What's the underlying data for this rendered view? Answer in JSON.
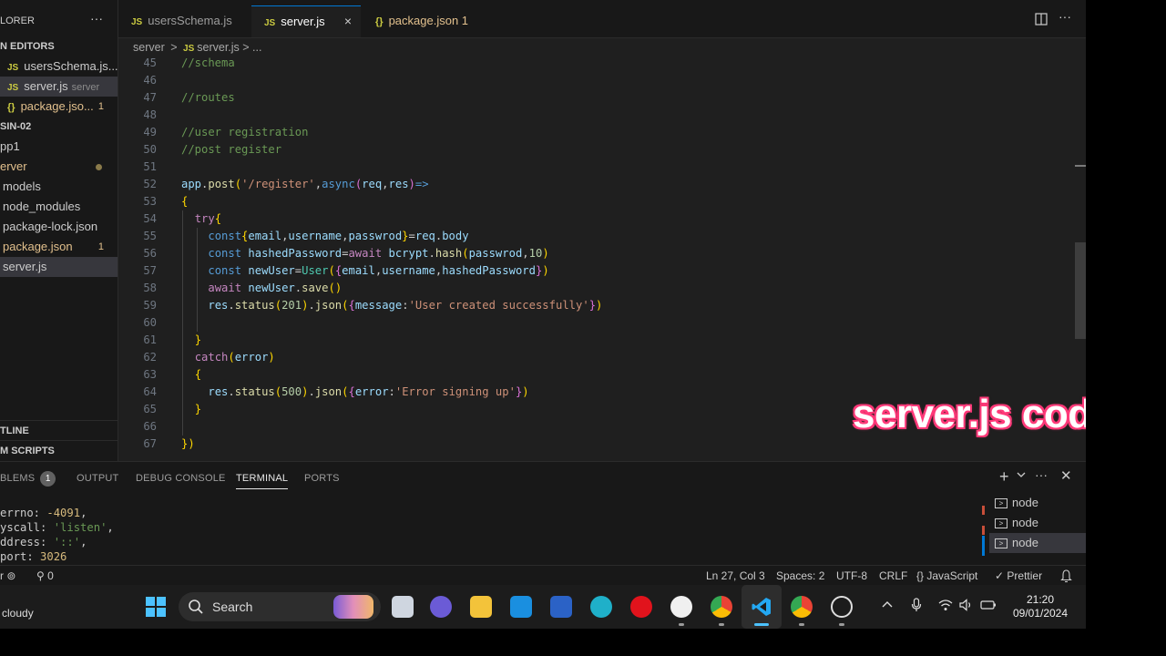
{
  "sidebar": {
    "explorer_title": "LORER",
    "open_editors_heading": "N EDITORS",
    "open_editors": [
      {
        "icon": "JS",
        "label": "usersSchema.js..."
      },
      {
        "icon": "JS",
        "label": "server.js",
        "hint": "server"
      },
      {
        "icon": "{}",
        "label": "package.jso...",
        "count": "1"
      }
    ],
    "folder_heading": "SIN-02",
    "tree": [
      {
        "label": "pp1"
      },
      {
        "label": "erver"
      },
      {
        "label": "models"
      },
      {
        "label": "node_modules"
      },
      {
        "label": "package-lock.json"
      },
      {
        "label": "package.json",
        "count": "1"
      },
      {
        "label": "server.js"
      }
    ],
    "outline_heading": "TLINE",
    "npm_heading": "M SCRIPTS"
  },
  "tabs": [
    {
      "icon": "JS",
      "label": "usersSchema.js"
    },
    {
      "icon": "JS",
      "label": "server.js",
      "close": "×"
    },
    {
      "icon": "{}",
      "label": "package.json 1"
    }
  ],
  "breadcrumb": {
    "folder": "server",
    "sep": ">",
    "file": "server.js",
    "tail": "> ..."
  },
  "editor": {
    "lines": [
      {
        "n": "45",
        "text": "//schema"
      },
      {
        "n": "46",
        "text": ""
      },
      {
        "n": "47",
        "text": "//routes"
      },
      {
        "n": "48",
        "text": ""
      },
      {
        "n": "49",
        "text": "//user registration"
      },
      {
        "n": "50",
        "text": "//post register"
      },
      {
        "n": "51",
        "text": ""
      },
      {
        "n": "52",
        "text": "app.post('/register',async(req,res)=>"
      },
      {
        "n": "53",
        "text": "{"
      },
      {
        "n": "54",
        "text": "  try{"
      },
      {
        "n": "55",
        "text": "    const{email,username,passwrod}=req.body"
      },
      {
        "n": "56",
        "text": "    const hashedPassword=await bcrypt.hash(passwrod,10)"
      },
      {
        "n": "57",
        "text": "    const newUser=User({email,username,hashedPassword})"
      },
      {
        "n": "58",
        "text": "    await newUser.save()"
      },
      {
        "n": "59",
        "text": "    res.status(201).json({message:'User created successfully'})"
      },
      {
        "n": "60",
        "text": ""
      },
      {
        "n": "61",
        "text": "  }"
      },
      {
        "n": "62",
        "text": "  catch(error)"
      },
      {
        "n": "63",
        "text": "  {"
      },
      {
        "n": "64",
        "text": "    res.status(500).json({error:'Error signing up'})"
      },
      {
        "n": "65",
        "text": "  }"
      },
      {
        "n": "66",
        "text": ""
      },
      {
        "n": "67",
        "text": "})"
      }
    ]
  },
  "panel": {
    "tabs": [
      {
        "label": "BLEMS",
        "badge": "1"
      },
      {
        "label": "OUTPUT"
      },
      {
        "label": "DEBUG CONSOLE"
      },
      {
        "label": "TERMINAL"
      },
      {
        "label": "PORTS"
      }
    ],
    "terminal_lines": [
      {
        "key": "errno: ",
        "value": "-4091",
        "tail": ","
      },
      {
        "key": "yscall: ",
        "value": "'listen'",
        "tail": ","
      },
      {
        "key": "ddress: ",
        "value": "'::'",
        "tail": ","
      },
      {
        "key": "port: ",
        "value": "3026",
        "tail": ""
      }
    ],
    "terminals": [
      {
        "label": "node"
      },
      {
        "label": "node"
      },
      {
        "label": "node"
      }
    ]
  },
  "statusbar": {
    "left_errors": "0",
    "position": "Ln 27, Col 3",
    "spaces": "Spaces: 2",
    "encoding": "UTF-8",
    "eol": "CRLF",
    "language": "JavaScript",
    "formatter": "Prettier"
  },
  "taskbar": {
    "weather": "cloudy",
    "search_placeholder": "Search",
    "time": "21:20",
    "date": "09/01/2024"
  },
  "overlay": {
    "caption": "server.js code"
  },
  "colors": {
    "accent": "#0078d4",
    "caption_glow": "#ff3b7a"
  }
}
